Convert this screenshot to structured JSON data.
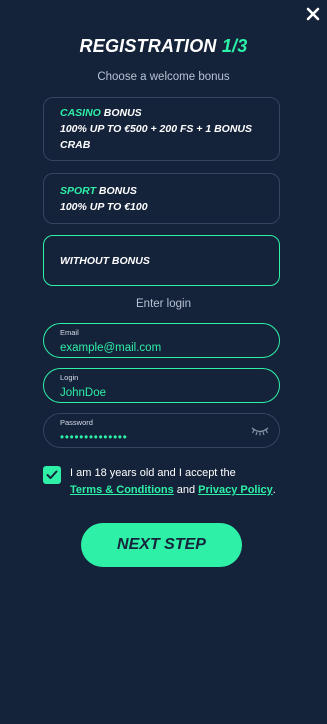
{
  "header": {
    "title": "REGISTRATION",
    "step": "1/3",
    "close_icon": "close-icon"
  },
  "bonus_section": {
    "prompt": "Choose a welcome bonus",
    "options": [
      {
        "accent": "CASINO",
        "name": " BONUS",
        "detail": "100% UP TO €500 + 200 FS + 1 BONUS CRAB",
        "selected": false
      },
      {
        "accent": "SPORT",
        "name": " BONUS",
        "detail": "100% UP TO €100",
        "selected": false
      },
      {
        "accent": "",
        "name": "WITHOUT BONUS",
        "detail": "",
        "selected": true
      }
    ]
  },
  "login_section": {
    "prompt": "Enter login",
    "email": {
      "label": "Email",
      "placeholder": "example@mail.com"
    },
    "login": {
      "label": "Login",
      "placeholder": "JohnDoe"
    },
    "password": {
      "label": "Password",
      "value": "••••••••••••••",
      "toggle_icon": "eye-closed-icon"
    }
  },
  "consent": {
    "checked": true,
    "text_before": "I am 18 years old and I accept the",
    "terms_link": "Terms & Conditions",
    "and": " and ",
    "privacy_link": "Privacy Policy",
    "end": "."
  },
  "actions": {
    "next_label": "NEXT STEP"
  },
  "colors": {
    "background": "#14223a",
    "accent": "#2ef0a7",
    "border": "#34455e"
  }
}
